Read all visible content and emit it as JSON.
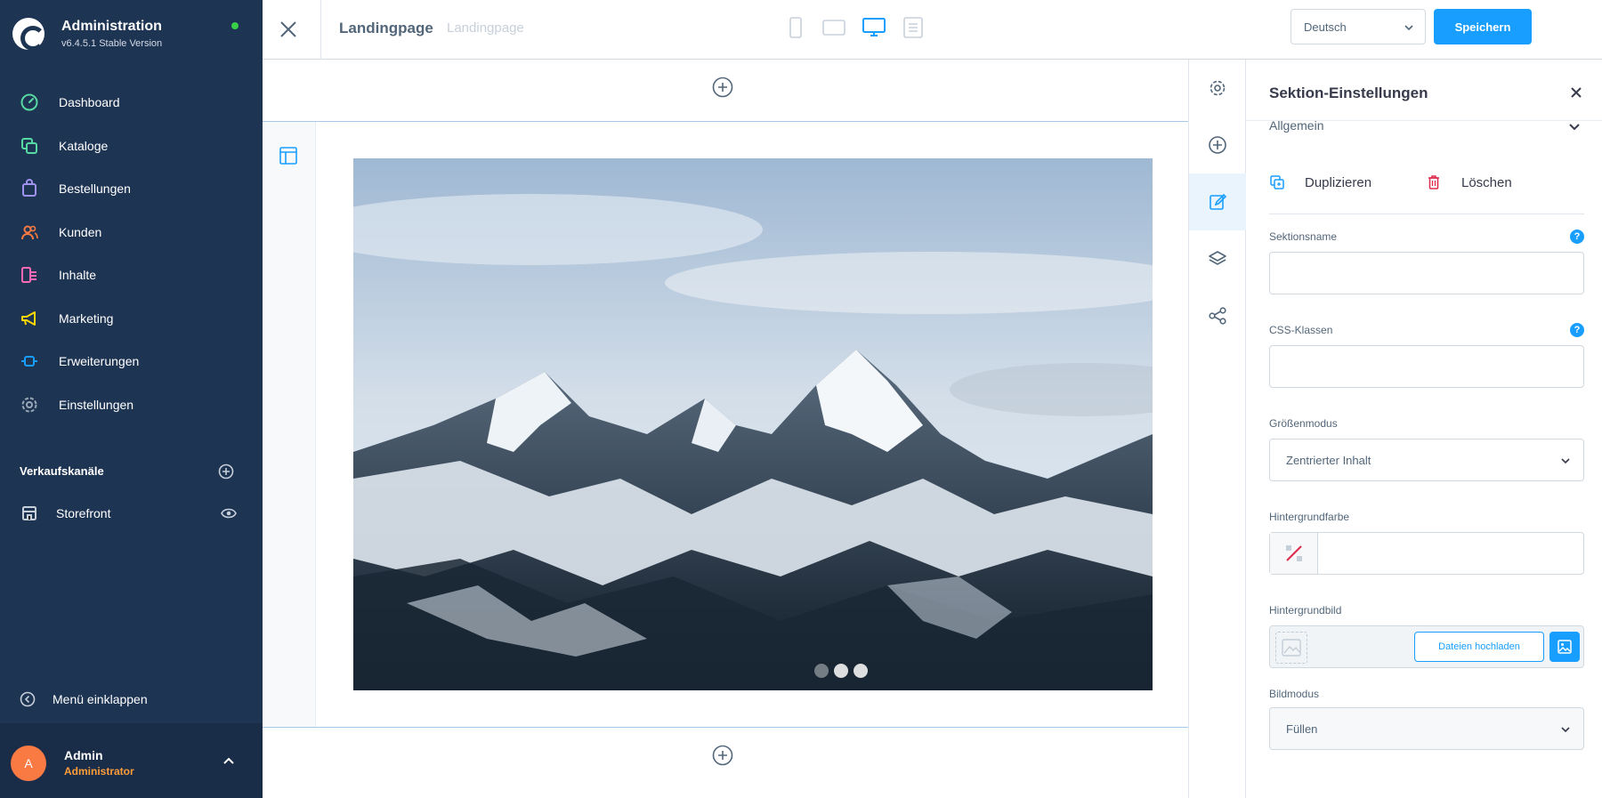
{
  "app": {
    "title": "Administration",
    "version": "v6.4.5.1 Stable Version"
  },
  "sidebar": {
    "items": [
      {
        "label": "Dashboard",
        "icon": "dashboard-icon",
        "color": "#57d9a3"
      },
      {
        "label": "Kataloge",
        "icon": "catalog-icon",
        "color": "#57d9a3"
      },
      {
        "label": "Bestellungen",
        "icon": "orders-icon",
        "color": "#a092f0"
      },
      {
        "label": "Kunden",
        "icon": "customers-icon",
        "color": "#f97a43"
      },
      {
        "label": "Inhalte",
        "icon": "content-icon",
        "color": "#ff68b4"
      },
      {
        "label": "Marketing",
        "icon": "marketing-icon",
        "color": "#ffd700"
      },
      {
        "label": "Erweiterungen",
        "icon": "extensions-icon",
        "color": "#189eff"
      },
      {
        "label": "Einstellungen",
        "icon": "settings-icon",
        "color": "#9aa8b5"
      }
    ],
    "channels_title": "Verkaufskanäle",
    "storefront_label": "Storefront",
    "collapse_label": "Menü einklappen"
  },
  "user": {
    "initial": "A",
    "name": "Admin",
    "role": "Administrator"
  },
  "topbar": {
    "title": "Landingpage",
    "subtitle": "Landingpage",
    "language": "Deutsch",
    "save_label": "Speichern",
    "active_device": "desktop"
  },
  "canvas": {
    "slider_dots": 3,
    "active_slide": 2
  },
  "panel": {
    "title": "Sektion-Einstellungen",
    "accordion_title": "Allgemein",
    "duplicate_label": "Duplizieren",
    "delete_label": "Löschen",
    "fields": {
      "section_name_label": "Sektionsname",
      "css_classes_label": "CSS-Klassen",
      "size_mode_label": "Größenmodus",
      "size_mode_value": "Zentrierter Inhalt",
      "bg_color_label": "Hintergrundfarbe",
      "bg_image_label": "Hintergrundbild",
      "upload_label": "Dateien hochladen",
      "image_mode_label": "Bildmodus",
      "image_mode_value": "Füllen"
    }
  },
  "colors": {
    "sidebar_bg": "#1e3453",
    "accent": "#189eff",
    "user_role": "#ff9d3a"
  }
}
